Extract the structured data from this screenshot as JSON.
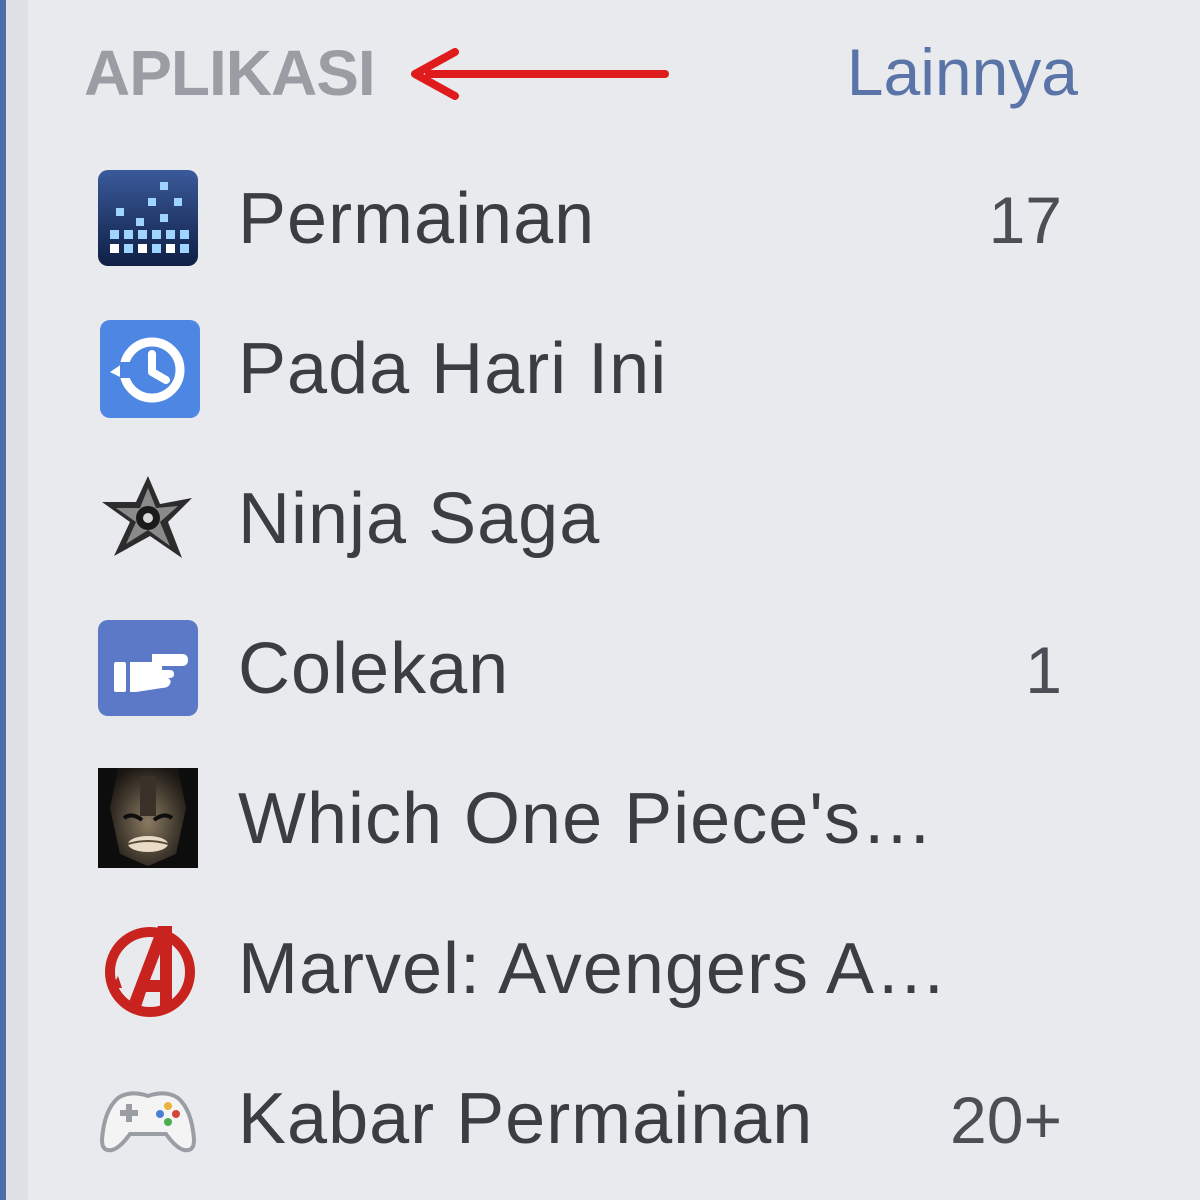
{
  "sidebar": {
    "section_title": "APLIKASI",
    "more_link": "Lainnya",
    "annotation_color": "#e01b1b",
    "items": [
      {
        "label": "Permainan",
        "count": "17",
        "icon": "games-grid-icon"
      },
      {
        "label": "Pada Hari Ini",
        "count": "",
        "icon": "on-this-day-clock-icon"
      },
      {
        "label": "Ninja Saga",
        "count": "",
        "icon": "ninja-saga-shuriken-icon"
      },
      {
        "label": "Colekan",
        "count": "1",
        "icon": "poke-hand-icon"
      },
      {
        "label": "Which One Piece's…",
        "count": "",
        "icon": "one-piece-quiz-icon"
      },
      {
        "label": "Marvel: Avengers A…",
        "count": "",
        "icon": "avengers-logo-icon"
      },
      {
        "label": "Kabar Permainan",
        "count": "20+",
        "icon": "game-controller-icon"
      }
    ]
  }
}
